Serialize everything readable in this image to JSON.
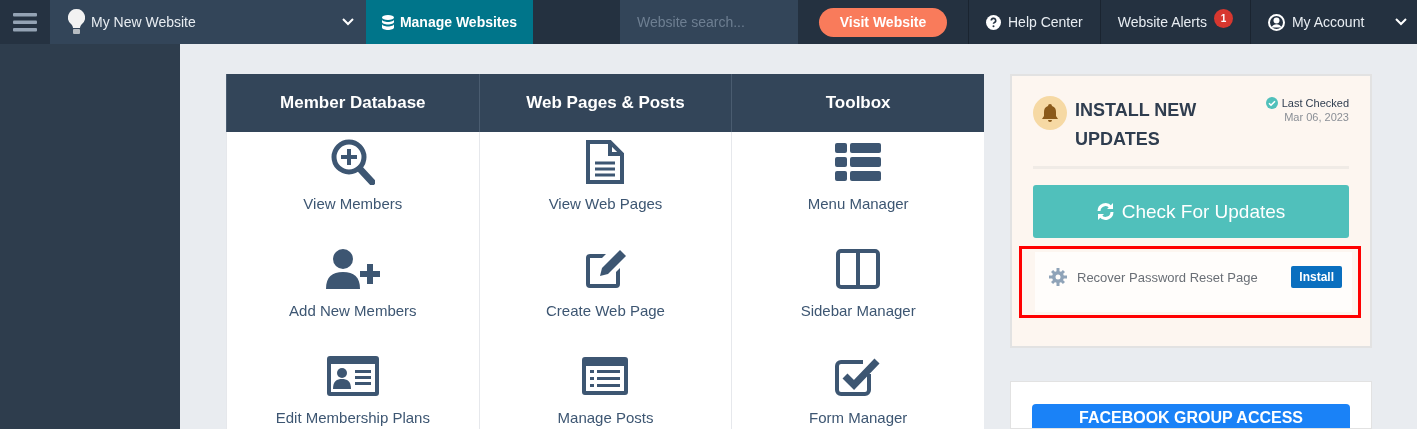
{
  "topbar": {
    "site_selector": "My New Website",
    "manage_button": "Manage Websites",
    "search": {
      "placeholder": "Website search..."
    },
    "visit_button": "Visit Website",
    "help_link": "Help Center",
    "alerts": {
      "label": "Website Alerts",
      "count": "1"
    },
    "account": "My Account"
  },
  "tools": {
    "columns": [
      {
        "heading": "Member Database",
        "items": [
          {
            "label": "View Members",
            "kind": "search"
          },
          {
            "label": "Add New Members",
            "kind": "user-add"
          },
          {
            "label": "Edit Membership Plans",
            "kind": "id-card"
          }
        ]
      },
      {
        "heading": "Web Pages & Posts",
        "items": [
          {
            "label": "View Web Pages",
            "kind": "document"
          },
          {
            "label": "Create Web Page",
            "kind": "edit"
          },
          {
            "label": "Manage Posts",
            "kind": "list"
          }
        ]
      },
      {
        "heading": "Toolbox",
        "items": [
          {
            "label": "Menu Manager",
            "kind": "menu"
          },
          {
            "label": "Sidebar Manager",
            "kind": "columns"
          },
          {
            "label": "Form Manager",
            "kind": "check"
          }
        ]
      }
    ]
  },
  "updates": {
    "title": "INSTALL NEW UPDATES",
    "last_checked_label": "Last Checked",
    "last_checked_date": "Mar 06, 2023",
    "check_button": "Check For Updates",
    "items": [
      {
        "label": "Recover Password Reset Page",
        "button": "Install",
        "highlighted": true
      }
    ]
  },
  "facebook": {
    "button": "FACEBOOK GROUP ACCESS"
  }
}
